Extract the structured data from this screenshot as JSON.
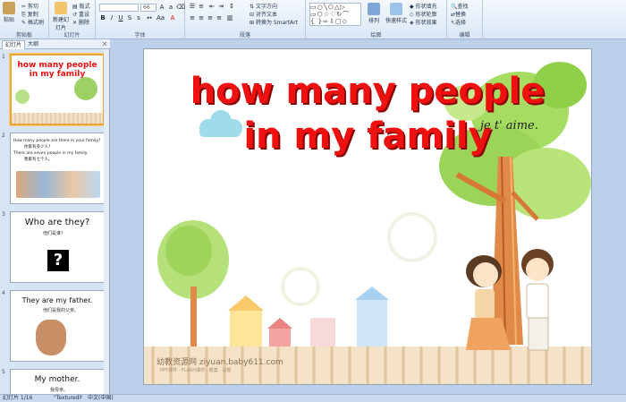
{
  "ribbon": {
    "clipboard": {
      "paste": "粘贴",
      "cut": "剪切",
      "copy": "复制",
      "format_painter": "格式刷",
      "label": "剪贴板"
    },
    "slides": {
      "new_slide": "新建幻灯片",
      "layout": "版式",
      "reset": "重设",
      "delete": "删除",
      "label": "幻灯片"
    },
    "font": {
      "font_size": "66",
      "label": "字体"
    },
    "paragraph": {
      "text_direction": "文字方向",
      "align_text": "对齐文本",
      "smartart": "转换为 SmartArt",
      "label": "段落"
    },
    "drawing": {
      "arrange": "排列",
      "quick_styles": "快速样式",
      "shape_fill": "形状填充",
      "shape_outline": "形状轮廓",
      "shape_effects": "形状效果",
      "label": "绘图"
    },
    "editing": {
      "find": "查找",
      "replace": "替换",
      "select": "选择",
      "label": "编辑"
    }
  },
  "left_panel": {
    "tabs": [
      "幻灯片",
      "大纲"
    ],
    "thumbnails": [
      {
        "number": "1",
        "lines": [
          "how many people",
          "in my family"
        ]
      },
      {
        "number": "2",
        "lines": [
          "How many people are there in your family?",
          "你家有多少人?",
          "There are seven people in my family.",
          "我家有七个人。"
        ]
      },
      {
        "number": "3",
        "lines": [
          "Who are they?",
          "他们是谁?",
          "?"
        ]
      },
      {
        "number": "4",
        "lines": [
          "They are my father.",
          "他们是我的父亲。"
        ]
      },
      {
        "number": "5",
        "lines": [
          "My mother.",
          "我母亲。"
        ]
      }
    ]
  },
  "slide": {
    "title_line1": "how many people",
    "title_line2": "in my family",
    "script_text": "je t' aime.",
    "watermark": "幼教资源网 ziyuan.baby611.com",
    "watermark_sub": "PPT课件 · FLASH课件 · 教案 · 试卷"
  },
  "status": {
    "slide_counter": "幻灯片 1/16",
    "theme": "\"Textured\"",
    "language": "中文(中国)"
  },
  "colors": {
    "title_red": "#ef1010",
    "ribbon_bg": "#dbe7f6",
    "workspace_bg": "#bcd0ea",
    "selected_border": "#e8a33c"
  }
}
